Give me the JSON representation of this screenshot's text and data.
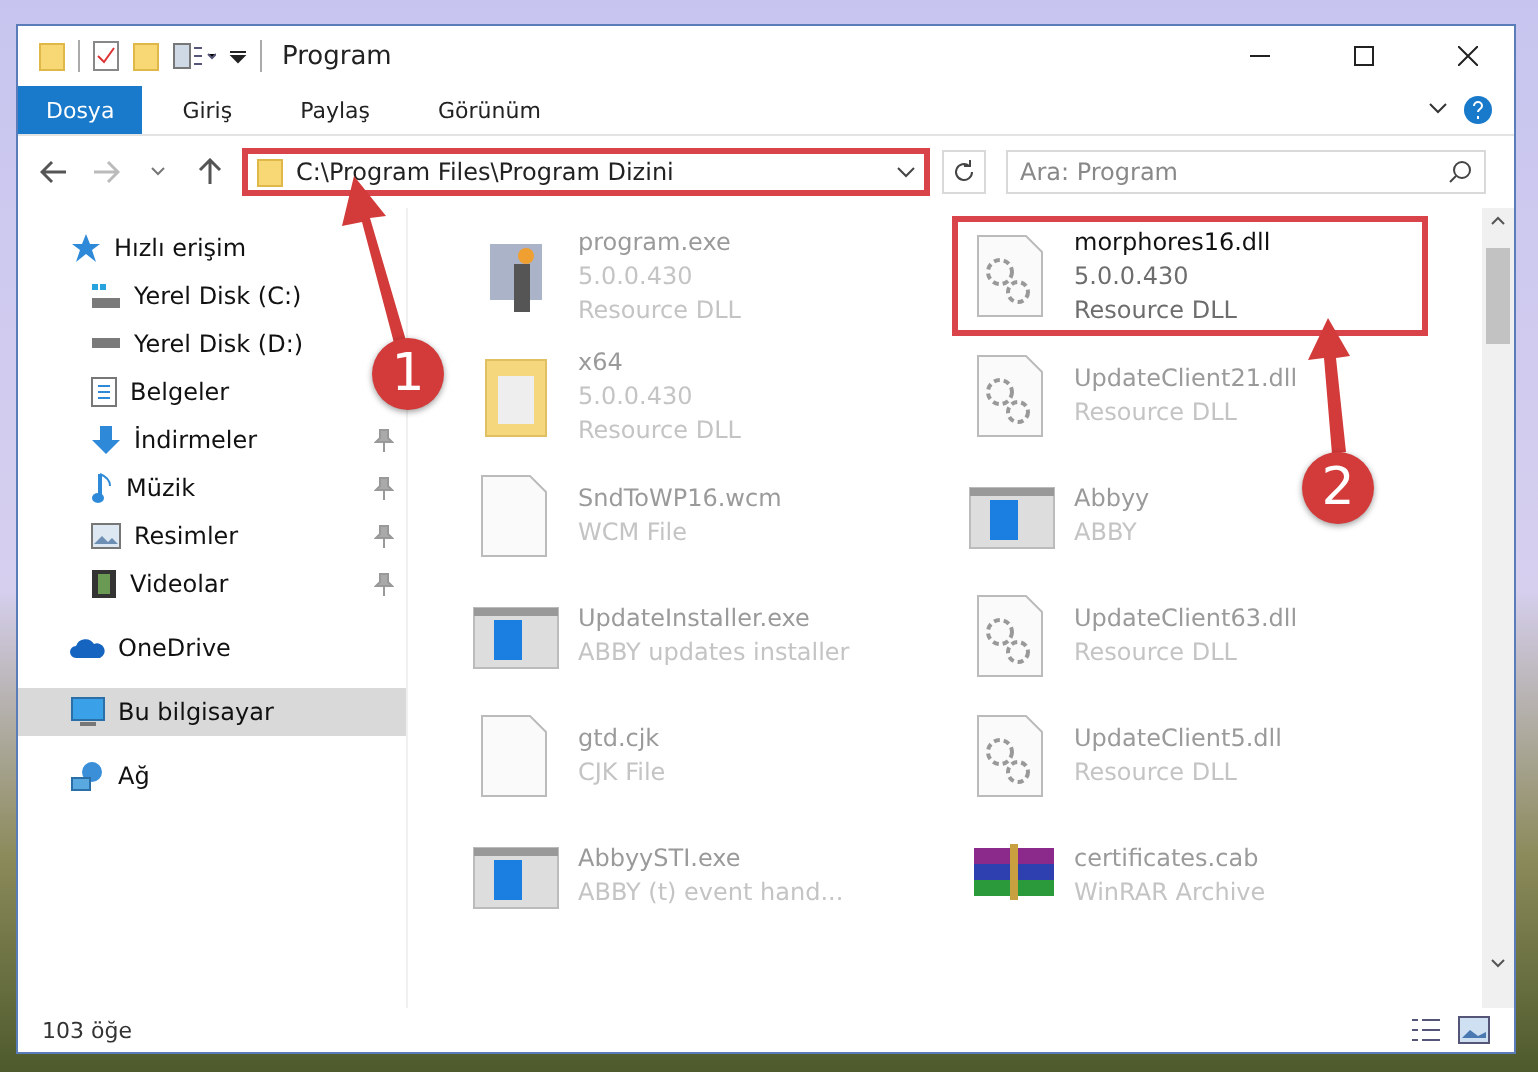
{
  "window": {
    "title": "Program"
  },
  "ribbon": {
    "tabs": [
      {
        "label": "Dosya",
        "selected": true
      },
      {
        "label": "Giriş",
        "selected": false
      },
      {
        "label": "Paylaş",
        "selected": false
      },
      {
        "label": "Görünüm",
        "selected": false
      }
    ]
  },
  "address": {
    "path": "C:\\Program Files\\Program Dizini",
    "highlighted": true
  },
  "search": {
    "placeholder": "Ara: Program"
  },
  "nav": [
    {
      "label": "Hızlı erişim",
      "kind": "star",
      "selected": false,
      "children": [
        {
          "label": "Yerel Disk (C:)",
          "kind": "system-drive",
          "pinned": false,
          "selected": false
        },
        {
          "label": "Yerel Disk (D:)",
          "kind": "drive",
          "pinned": false,
          "selected": false
        },
        {
          "label": "Belgeler",
          "kind": "document",
          "pinned": false,
          "selected": false
        },
        {
          "label": "İndirmeler",
          "kind": "download",
          "pinned": true,
          "selected": false
        },
        {
          "label": "Müzik",
          "kind": "music",
          "pinned": true,
          "selected": false
        },
        {
          "label": "Resimler",
          "kind": "pictures",
          "pinned": true,
          "selected": false
        },
        {
          "label": "Videolar",
          "kind": "video",
          "pinned": true,
          "selected": false
        }
      ]
    },
    {
      "label": "OneDrive",
      "kind": "cloud",
      "selected": false
    },
    {
      "label": "Bu bilgisayar",
      "kind": "computer",
      "selected": true
    },
    {
      "label": "Ağ",
      "kind": "network",
      "selected": false
    }
  ],
  "files": [
    {
      "kind": "installer",
      "lines": [
        "program.exe",
        "5.0.0.430",
        "Resource DLL"
      ],
      "blurred": true,
      "highlighted": false
    },
    {
      "kind": "dll",
      "lines": [
        "morphores16.dll",
        "5.0.0.430",
        "Resource DLL"
      ],
      "blurred": false,
      "highlighted": true
    },
    {
      "kind": "folder",
      "lines": [
        "x64",
        "5.0.0.430",
        "Resource DLL"
      ],
      "blurred": true,
      "highlighted": false
    },
    {
      "kind": "dll",
      "lines": [
        "UpdateClient21.dll",
        "Resource DLL"
      ],
      "blurred": true,
      "highlighted": false
    },
    {
      "kind": "blank",
      "lines": [
        "SndToWP16.wcm",
        "WCM File"
      ],
      "blurred": true,
      "highlighted": false
    },
    {
      "kind": "app",
      "lines": [
        "Abbyy",
        "ABBY"
      ],
      "blurred": true,
      "highlighted": false
    },
    {
      "kind": "app",
      "lines": [
        "UpdateInstaller.exe",
        "ABBY updates installer"
      ],
      "blurred": true,
      "highlighted": false
    },
    {
      "kind": "dll",
      "lines": [
        "UpdateClient63.dll",
        "Resource DLL"
      ],
      "blurred": true,
      "highlighted": false
    },
    {
      "kind": "blank",
      "lines": [
        "gtd.cjk",
        "CJK File"
      ],
      "blurred": true,
      "highlighted": false
    },
    {
      "kind": "dll",
      "lines": [
        "UpdateClient5.dll",
        "Resource DLL"
      ],
      "blurred": true,
      "highlighted": false
    },
    {
      "kind": "app",
      "lines": [
        "AbbyySTI.exe",
        "ABBY (t) event hand..."
      ],
      "blurred": true,
      "highlighted": false
    },
    {
      "kind": "archive",
      "lines": [
        "certificates.cab",
        "WinRAR Archive"
      ],
      "blurred": true,
      "highlighted": false
    }
  ],
  "status_bar": {
    "count": "103 öğe"
  },
  "annotations": [
    {
      "label": "1"
    },
    {
      "label": "2"
    }
  ]
}
